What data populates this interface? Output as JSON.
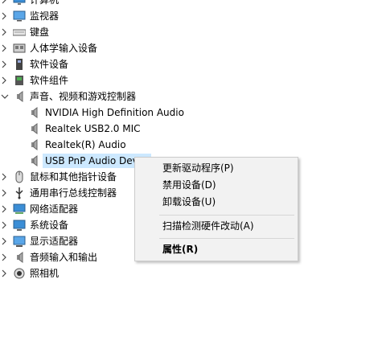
{
  "tree": {
    "items": [
      {
        "label": "计算机",
        "icon": "computer-icon",
        "expanded": false
      },
      {
        "label": "监视器",
        "icon": "monitor-icon",
        "expanded": false
      },
      {
        "label": "键盘",
        "icon": "keyboard-icon",
        "expanded": false
      },
      {
        "label": "人体学输入设备",
        "icon": "hid-icon",
        "expanded": false
      },
      {
        "label": "软件设备",
        "icon": "software-device-icon",
        "expanded": false
      },
      {
        "label": "软件组件",
        "icon": "software-component-icon",
        "expanded": false
      },
      {
        "label": "声音、视频和游戏控制器",
        "icon": "speaker-icon",
        "expanded": true,
        "children": [
          {
            "label": "NVIDIA High Definition Audio",
            "icon": "speaker-icon"
          },
          {
            "label": "Realtek USB2.0 MIC",
            "icon": "speaker-icon"
          },
          {
            "label": "Realtek(R) Audio",
            "icon": "speaker-icon"
          },
          {
            "label": "USB PnP Audio Dev",
            "icon": "speaker-icon",
            "selected": true
          }
        ]
      },
      {
        "label": "鼠标和其他指针设备",
        "icon": "mouse-icon",
        "expanded": false
      },
      {
        "label": "通用串行总线控制器",
        "icon": "usb-icon",
        "expanded": false
      },
      {
        "label": "网络适配器",
        "icon": "network-icon",
        "expanded": false
      },
      {
        "label": "系统设备",
        "icon": "system-device-icon",
        "expanded": false
      },
      {
        "label": "显示适配器",
        "icon": "display-adapter-icon",
        "expanded": false
      },
      {
        "label": "音频输入和输出",
        "icon": "audio-io-icon",
        "expanded": false
      },
      {
        "label": "照相机",
        "icon": "camera-icon",
        "expanded": false
      }
    ]
  },
  "context_menu": {
    "update_driver": "更新驱动程序(P)",
    "disable_device": "禁用设备(D)",
    "uninstall_device": "卸载设备(U)",
    "scan_hardware": "扫描检测硬件改动(A)",
    "properties": "属性(R)"
  },
  "colors": {
    "selection": "#cce8ff",
    "menu_bg": "#f2f2f2",
    "menu_border": "#cccccc"
  }
}
